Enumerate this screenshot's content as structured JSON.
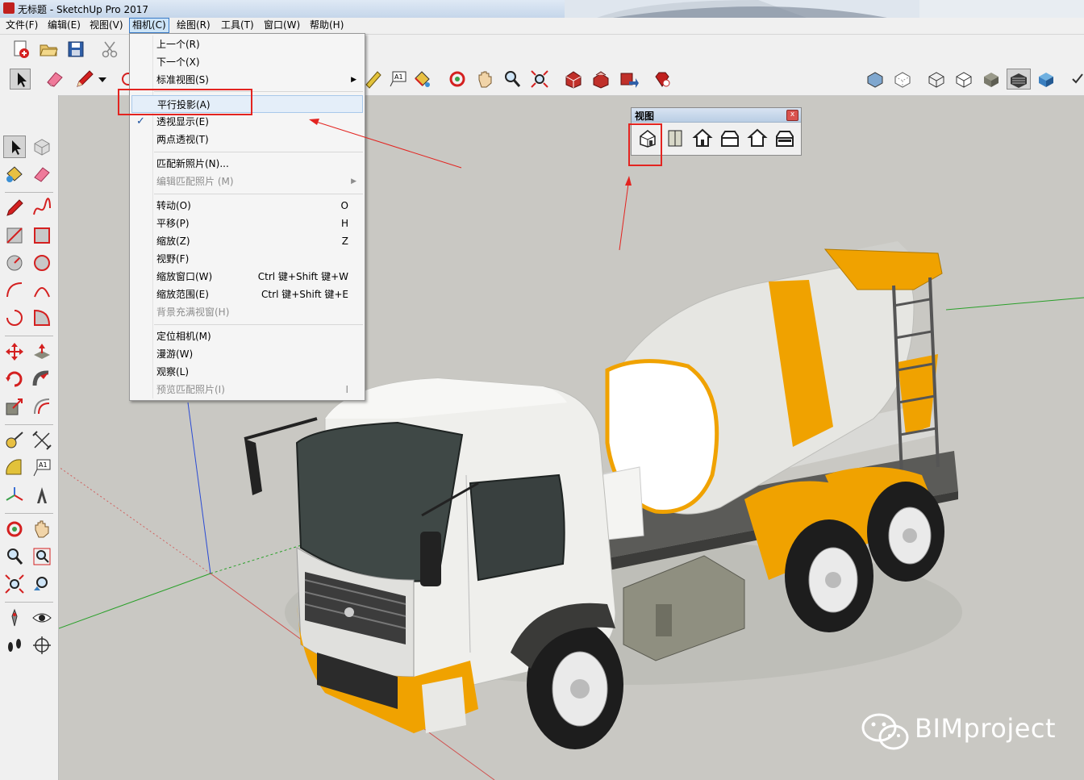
{
  "window": {
    "title": "无标题 - SketchUp Pro 2017"
  },
  "menubar": {
    "items": [
      {
        "id": "file",
        "label": "文件(F)"
      },
      {
        "id": "edit",
        "label": "编辑(E)"
      },
      {
        "id": "view",
        "label": "视图(V)"
      },
      {
        "id": "camera",
        "label": "相机(C)"
      },
      {
        "id": "draw",
        "label": "绘图(R)"
      },
      {
        "id": "tools",
        "label": "工具(T)"
      },
      {
        "id": "window",
        "label": "窗口(W)"
      },
      {
        "id": "help",
        "label": "帮助(H)"
      }
    ]
  },
  "camera_menu": {
    "items": [
      {
        "label": "上一个(R)",
        "shortcut": ""
      },
      {
        "label": "下一个(X)",
        "shortcut": ""
      },
      {
        "label": "标准视图(S)",
        "shortcut": ""
      },
      {
        "label": "平行投影(A)",
        "shortcut": ""
      },
      {
        "label": "透视显示(E)",
        "shortcut": ""
      },
      {
        "label": "两点透视(T)",
        "shortcut": ""
      },
      {
        "label": "匹配新照片(N)...",
        "shortcut": ""
      },
      {
        "label": "编辑匹配照片 (M)",
        "shortcut": ""
      },
      {
        "label": "转动(O)",
        "shortcut": "O"
      },
      {
        "label": "平移(P)",
        "shortcut": "H"
      },
      {
        "label": "缩放(Z)",
        "shortcut": "Z"
      },
      {
        "label": "视野(F)",
        "shortcut": ""
      },
      {
        "label": "缩放窗口(W)",
        "shortcut": "Ctrl 键+Shift 键+W"
      },
      {
        "label": "缩放范围(E)",
        "shortcut": "Ctrl 键+Shift 键+E"
      },
      {
        "label": "背景充满视窗(H)",
        "shortcut": ""
      },
      {
        "label": "定位相机(M)",
        "shortcut": ""
      },
      {
        "label": "漫游(W)",
        "shortcut": ""
      },
      {
        "label": "观察(L)",
        "shortcut": ""
      },
      {
        "label": "预览匹配照片(I)",
        "shortcut": "I"
      }
    ]
  },
  "view_panel": {
    "title": "视图",
    "close_label": "x"
  },
  "toolbar": {
    "text_tool_label": "A1"
  },
  "watermark": {
    "text": "BIMproject"
  },
  "colors": {
    "accent_red": "#e32420",
    "truck_yellow": "#f0a200",
    "menu_highlight": "#cde4f7"
  }
}
